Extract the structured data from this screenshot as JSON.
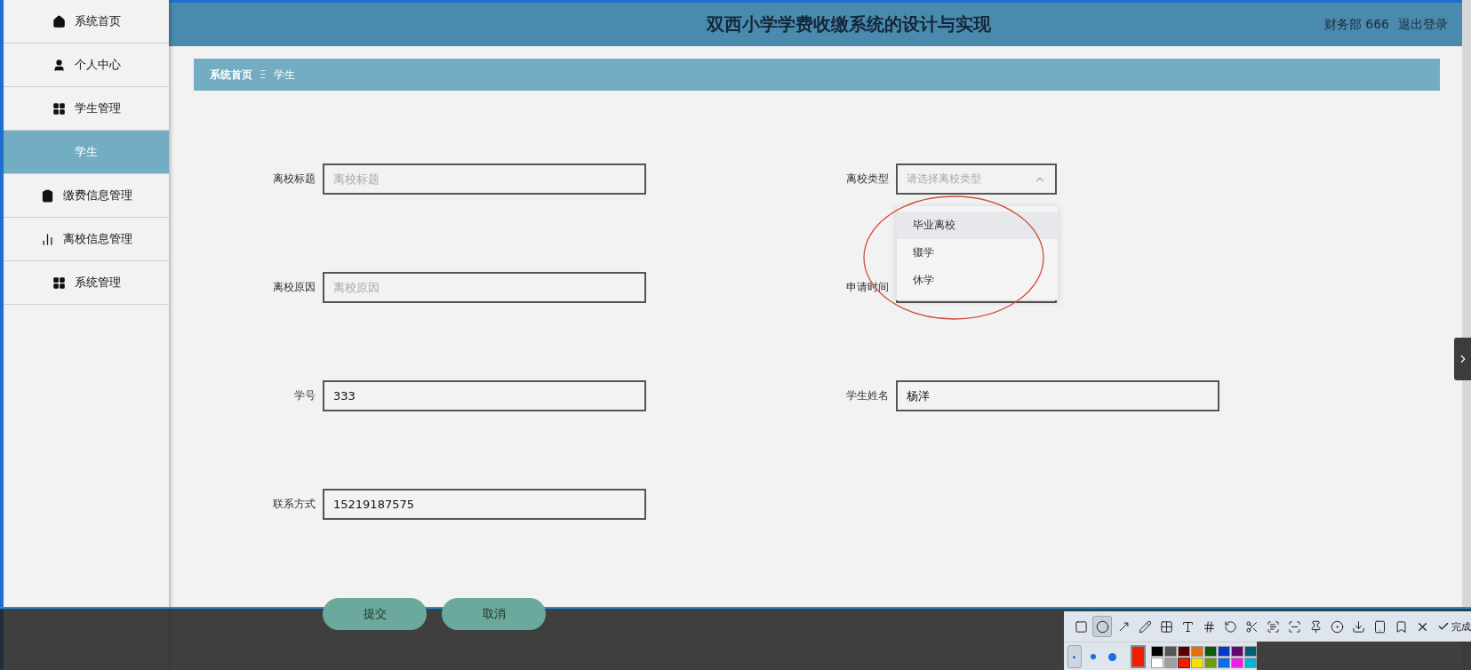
{
  "sidebar": {
    "items": [
      {
        "label": "系统首页",
        "kind": "menu",
        "selected": false
      },
      {
        "label": "个人中心",
        "kind": "menu",
        "selected": false
      },
      {
        "label": "学生管理",
        "kind": "menu",
        "selected": false
      },
      {
        "label": "学生",
        "kind": "sub",
        "selected": true
      },
      {
        "label": "缴费信息管理",
        "kind": "menu",
        "selected": false
      },
      {
        "label": "离校信息管理",
        "kind": "menu",
        "selected": false
      },
      {
        "label": "系统管理",
        "kind": "menu",
        "selected": false
      }
    ]
  },
  "header": {
    "title": "双西小学学费收缴系统的设计与实现",
    "user": "财务部 666",
    "logout": "退出登录"
  },
  "breadcrumb": {
    "home": "系统首页",
    "separator": "Ξ",
    "current": "学生"
  },
  "form": {
    "rows": [
      [
        {
          "label": "离校标题",
          "kind": "input",
          "placeholder": "离校标题"
        },
        {
          "label": "离校类型",
          "kind": "select",
          "placeholder": "请选择离校类型",
          "expanded": true,
          "options": [
            {
              "label": "毕业离校",
              "hovered": true
            },
            {
              "label": "辍学",
              "hovered": false
            },
            {
              "label": "休学",
              "hovered": false
            }
          ]
        }
      ],
      [
        {
          "label": "离校原因",
          "kind": "input",
          "placeholder": "离校原因"
        },
        {
          "label": "申请时间",
          "kind": "date"
        }
      ],
      [
        {
          "label": "学号",
          "kind": "input",
          "value": "333"
        },
        {
          "label": "学生姓名",
          "kind": "input",
          "value": "杨洋"
        }
      ],
      [
        {
          "label": "联系方式",
          "kind": "input",
          "value": "15219187575"
        }
      ]
    ],
    "buttons": [
      "提交",
      "取消"
    ]
  },
  "capture_toolbar": {
    "tools": [
      {
        "selected": false
      },
      {
        "selected": true
      },
      {
        "selected": false
      },
      {
        "selected": false
      },
      {
        "selected": false
      },
      {
        "selected": false
      },
      {
        "selected": false
      },
      {
        "selected": false
      },
      {
        "selected": false
      },
      {
        "selected": false
      },
      {
        "selected": false
      },
      {
        "selected": false
      },
      {
        "selected": false
      },
      {
        "selected": false
      },
      {
        "selected": false
      },
      {
        "selected": false
      }
    ],
    "done": "完成",
    "sizes": [
      {
        "selected": true
      },
      {
        "selected": false
      },
      {
        "selected": false
      }
    ],
    "swatches": [
      {
        "color": "#000000",
        "selected": false
      },
      {
        "color": "#555555",
        "selected": false
      },
      {
        "color": "#5a0000",
        "selected": false
      },
      {
        "color": "#e46f0a",
        "selected": false
      },
      {
        "color": "#0a5a0a",
        "selected": false
      },
      {
        "color": "#0a37c8",
        "selected": false
      },
      {
        "color": "#640a6e",
        "selected": false
      },
      {
        "color": "#005f73",
        "selected": false
      },
      {
        "color": "#ffffff",
        "selected": false
      },
      {
        "color": "#a0a0a0",
        "selected": false
      },
      {
        "color": "#f21d00",
        "selected": true
      },
      {
        "color": "#f5e100",
        "selected": false
      },
      {
        "color": "#6e9c0a",
        "selected": false
      },
      {
        "color": "#0a6ee6",
        "selected": false
      },
      {
        "color": "#f01ee6",
        "selected": false
      },
      {
        "color": "#00b4d2",
        "selected": false
      }
    ]
  }
}
